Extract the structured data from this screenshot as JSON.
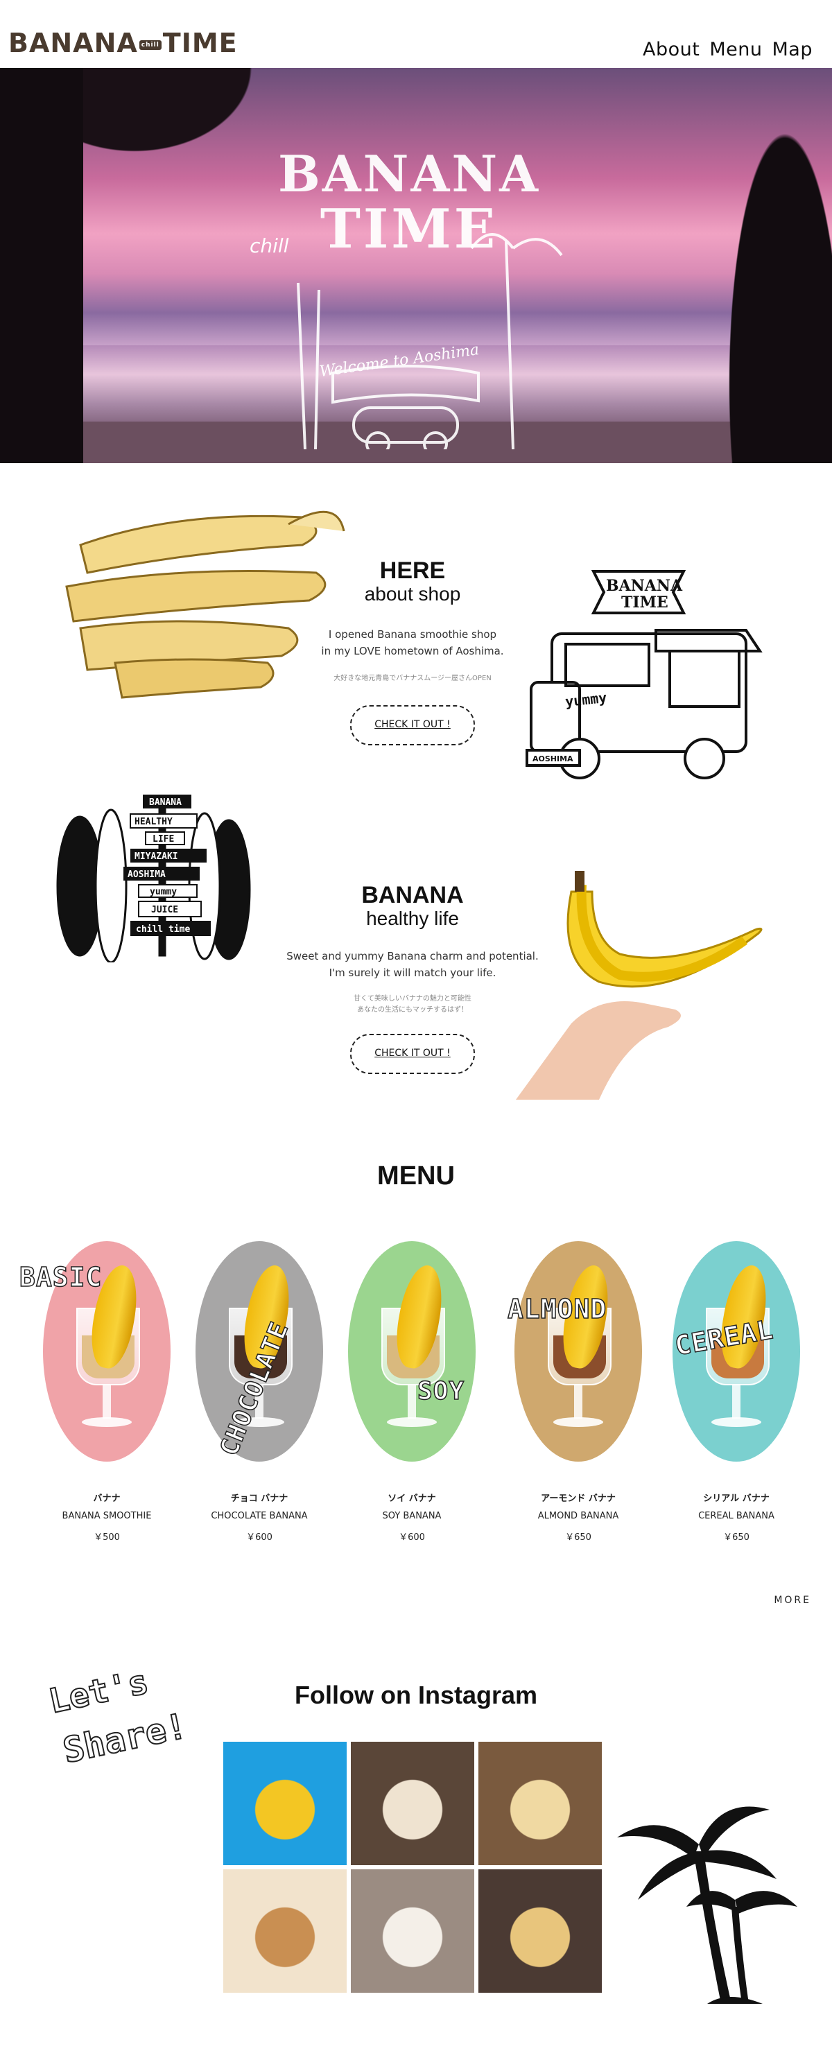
{
  "header": {
    "logo_left": "BANANA",
    "logo_mid": "chill",
    "logo_right": "TIME",
    "nav": [
      "About",
      "Menu",
      "Map"
    ]
  },
  "hero": {
    "sign_line1": "BANANA",
    "sign_line2": "TIME",
    "chill": "chill",
    "welcome": "Welcome to Aoshima"
  },
  "about": {
    "heading": "HERE",
    "subheading": "about shop",
    "desc_line1": "I opened Banana smoothie shop",
    "desc_line2": "in my LOVE hometown of Aoshima.",
    "jp": "大好きな地元青島でバナナスムージー屋さんOPEN",
    "button": "CHECK IT OUT !",
    "truck_sign_top": "BANANA",
    "truck_sign_bottom": "TIME",
    "truck_yummy": "yummy",
    "truck_plate": "AOSHIMA"
  },
  "healthy": {
    "heading": "BANANA",
    "subheading": "healthy life",
    "desc_line1": "Sweet and yummy Banana charm and potential.",
    "desc_line2": "I'm surely it will match your life.",
    "jp_line1": "甘くて美味しいバナナの魅力と可能性",
    "jp_line2": "あなたの生活にもマッチするはず！",
    "button": "CHECK IT OUT !",
    "signs": [
      "BANANA",
      "HEALTHY",
      "LIFE",
      "MIYAZAKI",
      "AOSHIMA",
      "yummy",
      "JUICE",
      "chill time"
    ]
  },
  "menu": {
    "title": "MENU",
    "more": "MORE",
    "items": [
      {
        "label": "BASIC",
        "jp": "バナナ",
        "en": "BANANA SMOOTHIE",
        "price": "￥500",
        "color": "#f0a3a8",
        "fill": "#e2c08a"
      },
      {
        "label": "CHOCOLATE",
        "jp": "チョコ バナナ",
        "en": "CHOCOLATE BANANA",
        "price": "￥600",
        "color": "#a7a6a6",
        "fill": "#4a3024"
      },
      {
        "label": "SOY",
        "jp": "ソイ バナナ",
        "en": "SOY BANANA",
        "price": "￥600",
        "color": "#9bd58f",
        "fill": "#d9b97e"
      },
      {
        "label": "ALMOND",
        "jp": "アーモンド バナナ",
        "en": "ALMOND BANANA",
        "price": "￥650",
        "color": "#cfa86e",
        "fill": "#8b4e2c"
      },
      {
        "label": "CEREAL",
        "jp": "シリアル バナナ",
        "en": "CEREAL BANANA",
        "price": "￥650",
        "color": "#7bd0cf",
        "fill": "#c87a3f"
      }
    ]
  },
  "instagram": {
    "lets_share_1": "Let's",
    "lets_share_2": "Share!",
    "title": "Follow on Instagram",
    "photos": [
      {
        "name": "banana-mug",
        "bg": "#1f9fe0",
        "accent": "#f3c623"
      },
      {
        "name": "smoothie-glass",
        "bg": "#5a4638",
        "accent": "#efe3d0"
      },
      {
        "name": "banana-slices",
        "bg": "#7a5a3e",
        "accent": "#f0d9a2"
      },
      {
        "name": "cream-drink",
        "bg": "#f2e3cc",
        "accent": "#c98f52"
      },
      {
        "name": "oatmeal-bowl",
        "bg": "#9b8c82",
        "accent": "#f4efe8"
      },
      {
        "name": "banana-shake",
        "bg": "#4b3a33",
        "accent": "#e8c57c"
      }
    ]
  }
}
